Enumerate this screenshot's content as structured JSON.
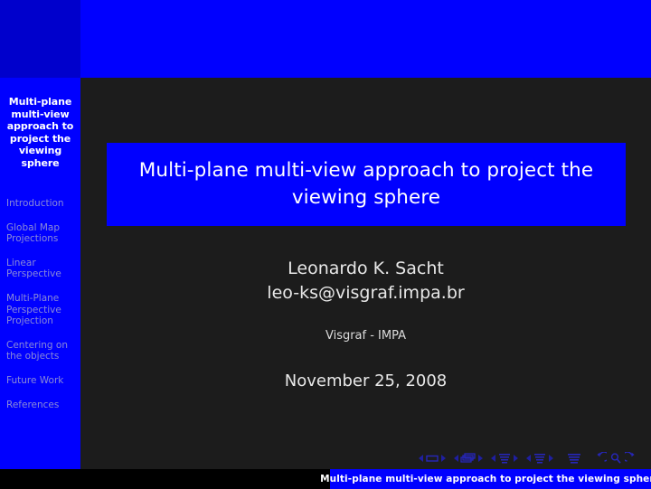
{
  "slide": {
    "background_color": "#1c1c1c",
    "accent_color": "#0000ff",
    "header_left_color": "#0000cc"
  },
  "sidebar": {
    "title": "Multi-plane multi-view approach to project the viewing sphere",
    "items": [
      {
        "label": "Introduction"
      },
      {
        "label": "Global Map Projections"
      },
      {
        "label": "Linear Perspective"
      },
      {
        "label": "Multi-Plane Perspective Projection"
      },
      {
        "label": "Centering on the objects"
      },
      {
        "label": "Future Work"
      },
      {
        "label": "References"
      }
    ]
  },
  "main": {
    "title": "Multi-plane multi-view approach to project the viewing sphere",
    "author": "Leonardo K. Sacht",
    "email": "leo-ks@visgraf.impa.br",
    "institute": "Visgraf - IMPA",
    "date": "November 25, 2008"
  },
  "navigation": {
    "symbols": [
      {
        "name": "slide-prev-icon",
        "glyph": "◀"
      },
      {
        "name": "slide-icon",
        "glyph": "▭"
      },
      {
        "name": "slide-next-icon",
        "glyph": "▶"
      },
      {
        "name": "frame-prev-icon",
        "glyph": "◀"
      },
      {
        "name": "frame-icon",
        "glyph": "⬚"
      },
      {
        "name": "frame-next-icon",
        "glyph": "▶"
      },
      {
        "name": "subsection-prev-icon",
        "glyph": "◀"
      },
      {
        "name": "subsection-icon",
        "glyph": "☰"
      },
      {
        "name": "subsection-next-icon",
        "glyph": "▶"
      },
      {
        "name": "section-prev-icon",
        "glyph": "◀"
      },
      {
        "name": "section-icon",
        "glyph": "☰"
      },
      {
        "name": "section-next-icon",
        "glyph": "▶"
      },
      {
        "name": "presentation-icon",
        "glyph": "☰"
      },
      {
        "name": "back-icon",
        "glyph": "↶"
      },
      {
        "name": "find-icon",
        "glyph": "⚲"
      },
      {
        "name": "forward-icon",
        "glyph": "↷"
      }
    ]
  },
  "footer": {
    "text": "Multi-plane multi-view approach to project the viewing sphere"
  }
}
